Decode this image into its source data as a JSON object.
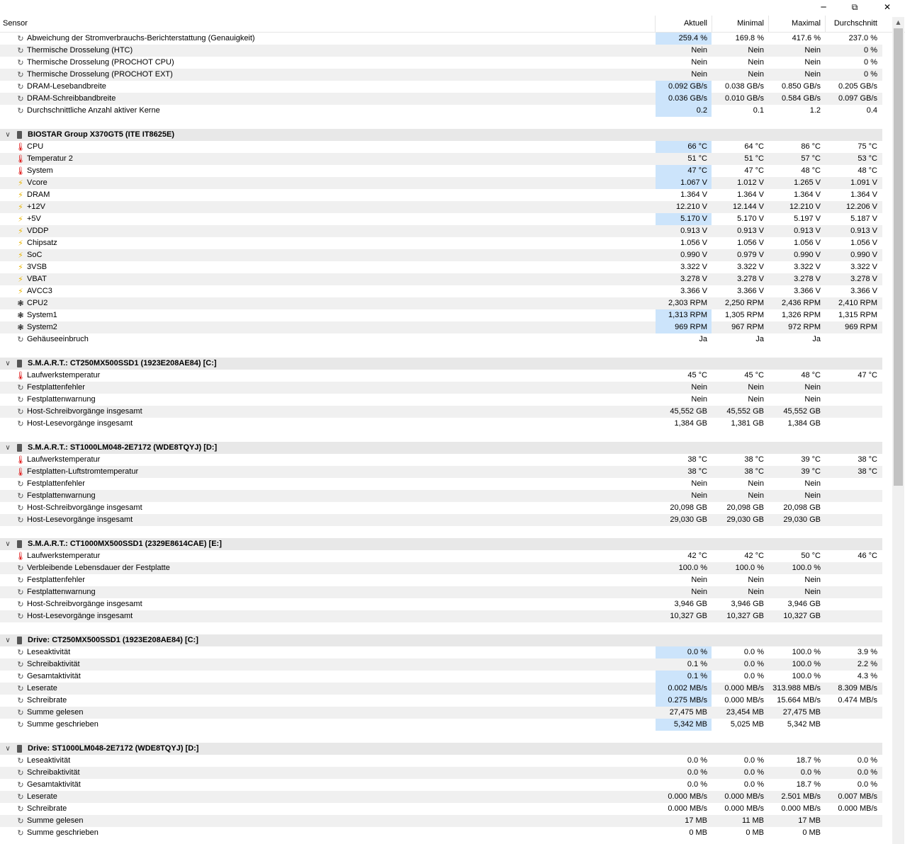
{
  "window": {
    "minimize_icon": "minimize-icon",
    "restore_icon": "restore-icon",
    "close_icon": "close-icon"
  },
  "columns": {
    "sensor": "Sensor",
    "current": "Aktuell",
    "min": "Minimal",
    "max": "Maximal",
    "avg": "Durchschnitt"
  },
  "colors": {
    "highlight": "#cce4fb",
    "thermometer": "#dd0000",
    "voltage": "#e8b400"
  },
  "rows": [
    {
      "t": "s",
      "i": "clock",
      "l": "Abweichung der Stromverbrauchs-Berichterstattung (Genauigkeit)",
      "v": [
        "259.4 %",
        "169.8 %",
        "417.6 %",
        "237.0 %"
      ],
      "h": 1
    },
    {
      "t": "s",
      "i": "clock",
      "l": "Thermische Drosselung (HTC)",
      "v": [
        "Nein",
        "Nein",
        "Nein",
        "0 %"
      ]
    },
    {
      "t": "s",
      "i": "clock",
      "l": "Thermische Drosselung (PROCHOT CPU)",
      "v": [
        "Nein",
        "Nein",
        "Nein",
        "0 %"
      ]
    },
    {
      "t": "s",
      "i": "clock",
      "l": "Thermische Drosselung (PROCHOT EXT)",
      "v": [
        "Nein",
        "Nein",
        "Nein",
        "0 %"
      ]
    },
    {
      "t": "s",
      "i": "clock",
      "l": "DRAM-Lesebandbreite",
      "v": [
        "0.092 GB/s",
        "0.038 GB/s",
        "0.850 GB/s",
        "0.205 GB/s"
      ],
      "h": 1
    },
    {
      "t": "s",
      "i": "clock",
      "l": "DRAM-Schreibbandbreite",
      "v": [
        "0.036 GB/s",
        "0.010 GB/s",
        "0.584 GB/s",
        "0.097 GB/s"
      ],
      "h": 1
    },
    {
      "t": "s",
      "i": "clock",
      "l": "Durchschnittliche Anzahl aktiver Kerne",
      "v": [
        "0.2",
        "0.1",
        "1.2",
        "0.4"
      ],
      "h": 1
    },
    {
      "t": "b"
    },
    {
      "t": "g",
      "l": "BIOSTAR Group X370GT5 (ITE IT8625E)"
    },
    {
      "t": "s",
      "i": "therm",
      "l": "CPU",
      "v": [
        "66 °C",
        "64 °C",
        "86 °C",
        "75 °C"
      ],
      "h": 1
    },
    {
      "t": "s",
      "i": "therm",
      "l": "Temperatur 2",
      "v": [
        "51 °C",
        "51 °C",
        "57 °C",
        "53 °C"
      ]
    },
    {
      "t": "s",
      "i": "therm",
      "l": "System",
      "v": [
        "47 °C",
        "47 °C",
        "48 °C",
        "48 °C"
      ],
      "h": 1
    },
    {
      "t": "s",
      "i": "volt",
      "l": "Vcore",
      "v": [
        "1.067 V",
        "1.012 V",
        "1.265 V",
        "1.091 V"
      ],
      "h": 1
    },
    {
      "t": "s",
      "i": "volt",
      "l": "DRAM",
      "v": [
        "1.364 V",
        "1.364 V",
        "1.364 V",
        "1.364 V"
      ]
    },
    {
      "t": "s",
      "i": "volt",
      "l": "+12V",
      "v": [
        "12.210 V",
        "12.144 V",
        "12.210 V",
        "12.206 V"
      ]
    },
    {
      "t": "s",
      "i": "volt",
      "l": "+5V",
      "v": [
        "5.170 V",
        "5.170 V",
        "5.197 V",
        "5.187 V"
      ],
      "h": 1
    },
    {
      "t": "s",
      "i": "volt",
      "l": "VDDP",
      "v": [
        "0.913 V",
        "0.913 V",
        "0.913 V",
        "0.913 V"
      ]
    },
    {
      "t": "s",
      "i": "volt",
      "l": "Chipsatz",
      "v": [
        "1.056 V",
        "1.056 V",
        "1.056 V",
        "1.056 V"
      ]
    },
    {
      "t": "s",
      "i": "volt",
      "l": "SoC",
      "v": [
        "0.990 V",
        "0.979 V",
        "0.990 V",
        "0.990 V"
      ]
    },
    {
      "t": "s",
      "i": "volt",
      "l": "3VSB",
      "v": [
        "3.322 V",
        "3.322 V",
        "3.322 V",
        "3.322 V"
      ]
    },
    {
      "t": "s",
      "i": "volt",
      "l": "VBAT",
      "v": [
        "3.278 V",
        "3.278 V",
        "3.278 V",
        "3.278 V"
      ]
    },
    {
      "t": "s",
      "i": "volt",
      "l": "AVCC3",
      "v": [
        "3.366 V",
        "3.366 V",
        "3.366 V",
        "3.366 V"
      ]
    },
    {
      "t": "s",
      "i": "fan",
      "l": "CPU2",
      "v": [
        "2,303 RPM",
        "2,250 RPM",
        "2,436 RPM",
        "2,410 RPM"
      ]
    },
    {
      "t": "s",
      "i": "fan",
      "l": "System1",
      "v": [
        "1,313 RPM",
        "1,305 RPM",
        "1,326 RPM",
        "1,315 RPM"
      ],
      "h": 1
    },
    {
      "t": "s",
      "i": "fan",
      "l": "System2",
      "v": [
        "969 RPM",
        "967 RPM",
        "972 RPM",
        "969 RPM"
      ],
      "h": 1
    },
    {
      "t": "s",
      "i": "clock",
      "l": "Gehäuseeinbruch",
      "v": [
        "Ja",
        "Ja",
        "Ja",
        ""
      ]
    },
    {
      "t": "b"
    },
    {
      "t": "g",
      "l": "S.M.A.R.T.: CT250MX500SSD1 (1923E208AE84) [C:]"
    },
    {
      "t": "s",
      "i": "therm",
      "l": "Laufwerkstemperatur",
      "v": [
        "45 °C",
        "45 °C",
        "48 °C",
        "47 °C"
      ]
    },
    {
      "t": "s",
      "i": "clock",
      "l": "Festplattenfehler",
      "v": [
        "Nein",
        "Nein",
        "Nein",
        ""
      ]
    },
    {
      "t": "s",
      "i": "clock",
      "l": "Festplattenwarnung",
      "v": [
        "Nein",
        "Nein",
        "Nein",
        ""
      ]
    },
    {
      "t": "s",
      "i": "clock",
      "l": "Host-Schreibvorgänge insgesamt",
      "v": [
        "45,552 GB",
        "45,552 GB",
        "45,552 GB",
        ""
      ]
    },
    {
      "t": "s",
      "i": "clock",
      "l": "Host-Lesevorgänge insgesamt",
      "v": [
        "1,384 GB",
        "1,381 GB",
        "1,384 GB",
        ""
      ]
    },
    {
      "t": "b"
    },
    {
      "t": "g",
      "l": "S.M.A.R.T.: ST1000LM048-2E7172 (WDE8TQYJ) [D:]"
    },
    {
      "t": "s",
      "i": "therm",
      "l": "Laufwerkstemperatur",
      "v": [
        "38 °C",
        "38 °C",
        "39 °C",
        "38 °C"
      ]
    },
    {
      "t": "s",
      "i": "therm",
      "l": "Festplatten-Luftstromtemperatur",
      "v": [
        "38 °C",
        "38 °C",
        "39 °C",
        "38 °C"
      ]
    },
    {
      "t": "s",
      "i": "clock",
      "l": "Festplattenfehler",
      "v": [
        "Nein",
        "Nein",
        "Nein",
        ""
      ]
    },
    {
      "t": "s",
      "i": "clock",
      "l": "Festplattenwarnung",
      "v": [
        "Nein",
        "Nein",
        "Nein",
        ""
      ]
    },
    {
      "t": "s",
      "i": "clock",
      "l": "Host-Schreibvorgänge insgesamt",
      "v": [
        "20,098 GB",
        "20,098 GB",
        "20,098 GB",
        ""
      ]
    },
    {
      "t": "s",
      "i": "clock",
      "l": "Host-Lesevorgänge insgesamt",
      "v": [
        "29,030 GB",
        "29,030 GB",
        "29,030 GB",
        ""
      ]
    },
    {
      "t": "b"
    },
    {
      "t": "g",
      "l": "S.M.A.R.T.: CT1000MX500SSD1 (2329E8614CAE) [E:]"
    },
    {
      "t": "s",
      "i": "therm",
      "l": "Laufwerkstemperatur",
      "v": [
        "42 °C",
        "42 °C",
        "50 °C",
        "46 °C"
      ]
    },
    {
      "t": "s",
      "i": "clock",
      "l": "Verbleibende Lebensdauer der Festplatte",
      "v": [
        "100.0 %",
        "100.0 %",
        "100.0 %",
        ""
      ]
    },
    {
      "t": "s",
      "i": "clock",
      "l": "Festplattenfehler",
      "v": [
        "Nein",
        "Nein",
        "Nein",
        ""
      ]
    },
    {
      "t": "s",
      "i": "clock",
      "l": "Festplattenwarnung",
      "v": [
        "Nein",
        "Nein",
        "Nein",
        ""
      ]
    },
    {
      "t": "s",
      "i": "clock",
      "l": "Host-Schreibvorgänge insgesamt",
      "v": [
        "3,946 GB",
        "3,946 GB",
        "3,946 GB",
        ""
      ]
    },
    {
      "t": "s",
      "i": "clock",
      "l": "Host-Lesevorgänge insgesamt",
      "v": [
        "10,327 GB",
        "10,327 GB",
        "10,327 GB",
        ""
      ]
    },
    {
      "t": "b"
    },
    {
      "t": "g",
      "l": "Drive: CT250MX500SSD1 (1923E208AE84) [C:]"
    },
    {
      "t": "s",
      "i": "clock",
      "l": "Leseaktivität",
      "v": [
        "0.0 %",
        "0.0 %",
        "100.0 %",
        "3.9 %"
      ],
      "h": 1
    },
    {
      "t": "s",
      "i": "clock",
      "l": "Schreibaktivität",
      "v": [
        "0.1 %",
        "0.0 %",
        "100.0 %",
        "2.2 %"
      ]
    },
    {
      "t": "s",
      "i": "clock",
      "l": "Gesamtaktivität",
      "v": [
        "0.1 %",
        "0.0 %",
        "100.0 %",
        "4.3 %"
      ],
      "h": 1
    },
    {
      "t": "s",
      "i": "clock",
      "l": "Leserate",
      "v": [
        "0.002 MB/s",
        "0.000 MB/s",
        "313.988 MB/s",
        "8.309 MB/s"
      ],
      "h": 1
    },
    {
      "t": "s",
      "i": "clock",
      "l": "Schreibrate",
      "v": [
        "0.275 MB/s",
        "0.000 MB/s",
        "15.664 MB/s",
        "0.474 MB/s"
      ],
      "h": 1
    },
    {
      "t": "s",
      "i": "clock",
      "l": "Summe gelesen",
      "v": [
        "27,475 MB",
        "23,454 MB",
        "27,475 MB",
        ""
      ]
    },
    {
      "t": "s",
      "i": "clock",
      "l": "Summe geschrieben",
      "v": [
        "5,342 MB",
        "5,025 MB",
        "5,342 MB",
        ""
      ],
      "h": 1
    },
    {
      "t": "b"
    },
    {
      "t": "g",
      "l": "Drive: ST1000LM048-2E7172 (WDE8TQYJ) [D:]"
    },
    {
      "t": "s",
      "i": "clock",
      "l": "Leseaktivität",
      "v": [
        "0.0 %",
        "0.0 %",
        "18.7 %",
        "0.0 %"
      ]
    },
    {
      "t": "s",
      "i": "clock",
      "l": "Schreibaktivität",
      "v": [
        "0.0 %",
        "0.0 %",
        "0.0 %",
        "0.0 %"
      ]
    },
    {
      "t": "s",
      "i": "clock",
      "l": "Gesamtaktivität",
      "v": [
        "0.0 %",
        "0.0 %",
        "18.7 %",
        "0.0 %"
      ]
    },
    {
      "t": "s",
      "i": "clock",
      "l": "Leserate",
      "v": [
        "0.000 MB/s",
        "0.000 MB/s",
        "2.501 MB/s",
        "0.007 MB/s"
      ]
    },
    {
      "t": "s",
      "i": "clock",
      "l": "Schreibrate",
      "v": [
        "0.000 MB/s",
        "0.000 MB/s",
        "0.000 MB/s",
        "0.000 MB/s"
      ]
    },
    {
      "t": "s",
      "i": "clock",
      "l": "Summe gelesen",
      "v": [
        "17 MB",
        "11 MB",
        "17 MB",
        ""
      ]
    },
    {
      "t": "s",
      "i": "clock",
      "l": "Summe geschrieben",
      "v": [
        "0 MB",
        "0 MB",
        "0 MB",
        ""
      ]
    }
  ]
}
